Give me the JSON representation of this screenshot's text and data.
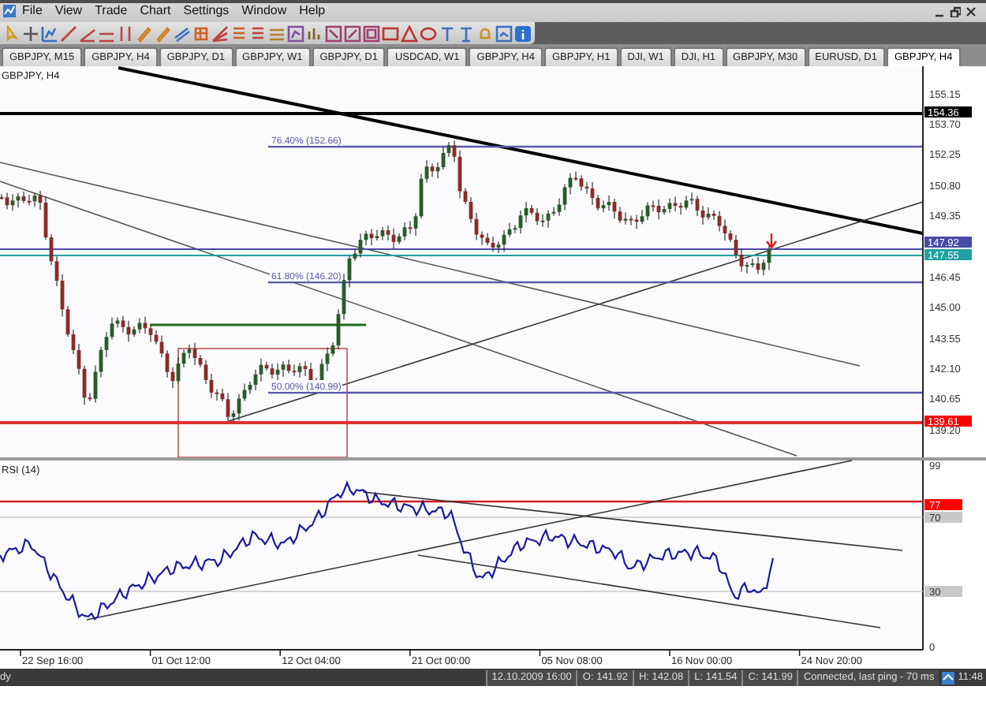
{
  "menu": [
    "File",
    "View",
    "Trade",
    "Chart",
    "Settings",
    "Window",
    "Help"
  ],
  "tabs": [
    {
      "label": "GBPJPY, M15",
      "selected": false
    },
    {
      "label": "GBPJPY, H4",
      "selected": false
    },
    {
      "label": "GBPJPY, D1",
      "selected": false
    },
    {
      "label": "GBPJPY, W1",
      "selected": false
    },
    {
      "label": "GBPJPY, D1",
      "selected": false
    },
    {
      "label": "USDCAD, W1",
      "selected": false
    },
    {
      "label": "GBPJPY, H4",
      "selected": false
    },
    {
      "label": "GBPJPY, H1",
      "selected": false
    },
    {
      "label": "DJI, W1",
      "selected": false
    },
    {
      "label": "DJI, H1",
      "selected": false
    },
    {
      "label": "GBPJPY, M30",
      "selected": false
    },
    {
      "label": "EURUSD, D1",
      "selected": false
    },
    {
      "label": "GBPJPY, H4",
      "selected": true
    }
  ],
  "chart": {
    "title": "GBPJPY, H4",
    "fib_labels": [
      "76.40% (152.66)",
      "61.80% (146.20)",
      "50.00% (140.99)"
    ],
    "price_ticks": [
      "155.15",
      "153.70",
      "152.25",
      "150.80",
      "149.35",
      "146.45",
      "145.00",
      "143.55",
      "142.10",
      "140.65",
      "139.20"
    ],
    "price_markers": [
      {
        "label": "154.36",
        "color": "#000000"
      },
      {
        "label": "147.92",
        "color": "#4a4aa8"
      },
      {
        "label": "147.55",
        "color": "#20a0a0"
      },
      {
        "label": "139.61",
        "color": "#ff0000"
      }
    ],
    "time_ticks": [
      "22 Sep 16:00",
      "01 Oct 12:00",
      "12 Oct 04:00",
      "21 Oct 00:00",
      "05 Nov 08:00",
      "16 Nov 00:00",
      "24 Nov 20:00"
    ]
  },
  "indicator": {
    "title": "RSI (14)",
    "ticks": [
      "99",
      "70",
      "30",
      "0"
    ],
    "markers": [
      {
        "label": "77",
        "color": "#ff0000"
      }
    ]
  },
  "status_bar": {
    "left": "dy",
    "fields": [
      "12.10.2009 16:00",
      "O: 141.92",
      "H: 142.08",
      "L: 141.54",
      "C: 141.99"
    ],
    "connection": "Connected, last ping - 70 ms",
    "clock": "11:48"
  }
}
